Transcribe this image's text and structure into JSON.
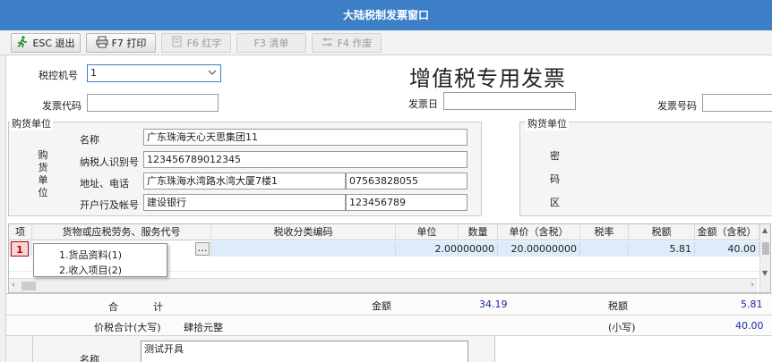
{
  "window": {
    "title": "大陆税制发票窗口"
  },
  "toolbar": {
    "esc_label": "ESC 退出",
    "print_label": "F7 打印",
    "red_label": "F6 红字",
    "list_label": "F3 清单",
    "void_label": "F4 作废"
  },
  "header": {
    "tax_machine_label": "税控机号",
    "tax_machine_value": "1",
    "invoice_title": "增值税专用发票",
    "invoice_code_label": "发票代码",
    "invoice_date_label": "发票日",
    "invoice_number_label": "发票号码"
  },
  "buyer": {
    "group_title": "购货单位",
    "side_label": [
      "购",
      "货",
      "单",
      "位"
    ],
    "name_label": "名称",
    "name_value": "广东珠海天心天思集团11",
    "tax_id_label": "纳税人识别号",
    "tax_id_value": "123456789012345",
    "address_label": "地址、电话",
    "address_value": "广东珠海水湾路水湾大厦7楼1",
    "phone_value": "07563828055",
    "bank_label": "开户行及帐号",
    "bank_value": "建设银行",
    "account_value": "123456789"
  },
  "cipher": {
    "group_title": "购货单位",
    "chars": [
      "密",
      "码",
      "区"
    ]
  },
  "table": {
    "columns": [
      "项",
      "货物或应税劳务、服务代号",
      "税收分类编码",
      "单位",
      "数量",
      "单价（含税）",
      "税率",
      "税额",
      "金额（含税）"
    ],
    "rows": [
      {
        "index": "1",
        "code": "",
        "tax_code": "",
        "unit": "",
        "quantity": "2.00000000",
        "unit_price": "20.00000000",
        "rate": "",
        "tax": "5.81",
        "amount": "40.00"
      }
    ],
    "dots_label": "…"
  },
  "popup": {
    "items": [
      "1.货品资料(1)",
      "2.收入项目(2)"
    ]
  },
  "summary": {
    "total_label_1": "合",
    "total_label_2": "计",
    "amount_label": "金额",
    "amount_value": "34.19",
    "tax_label": "税额",
    "tax_value": "5.81",
    "grand_label": "价税合计(大写)",
    "grand_words": "肆拾元整",
    "small_label": "(小写)",
    "small_value": "40.00"
  },
  "seller": {
    "name_label": "名称",
    "name_value": "测试开具"
  },
  "colors": {
    "title_bar": "#3c7fc6",
    "selected_row": "#dcecfb",
    "index_marker": "#c00000",
    "amount_text": "#1a2b9c"
  }
}
